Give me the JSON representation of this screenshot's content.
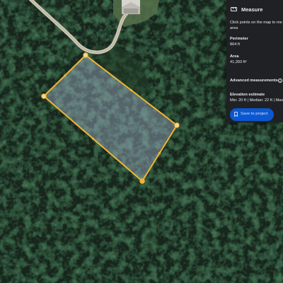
{
  "measure_panel": {
    "title": "Measure",
    "instruction_line_1": "Click points on the map to me",
    "instruction_line_2": "area",
    "perimeter_label": "Perimeter",
    "perimeter_value": "864 ft",
    "area_label": "Area",
    "area_value": "41,393 ft²",
    "advanced_label": "Advanced measurements",
    "elevation_label": "Elevation estimate",
    "elevation_value": "Min: 20 ft  |  Median: 22 ft  |  Max",
    "save_label": "Save to project"
  },
  "icons": {
    "measure": "ruler-icon",
    "info": "info-icon",
    "save": "bookmark-icon"
  },
  "colors": {
    "polygon_outline": "#f2b531",
    "polygon_fill": "rgba(160,175,200,0.45)",
    "panel_background": "#202124",
    "save_button": "#0b57d0"
  }
}
